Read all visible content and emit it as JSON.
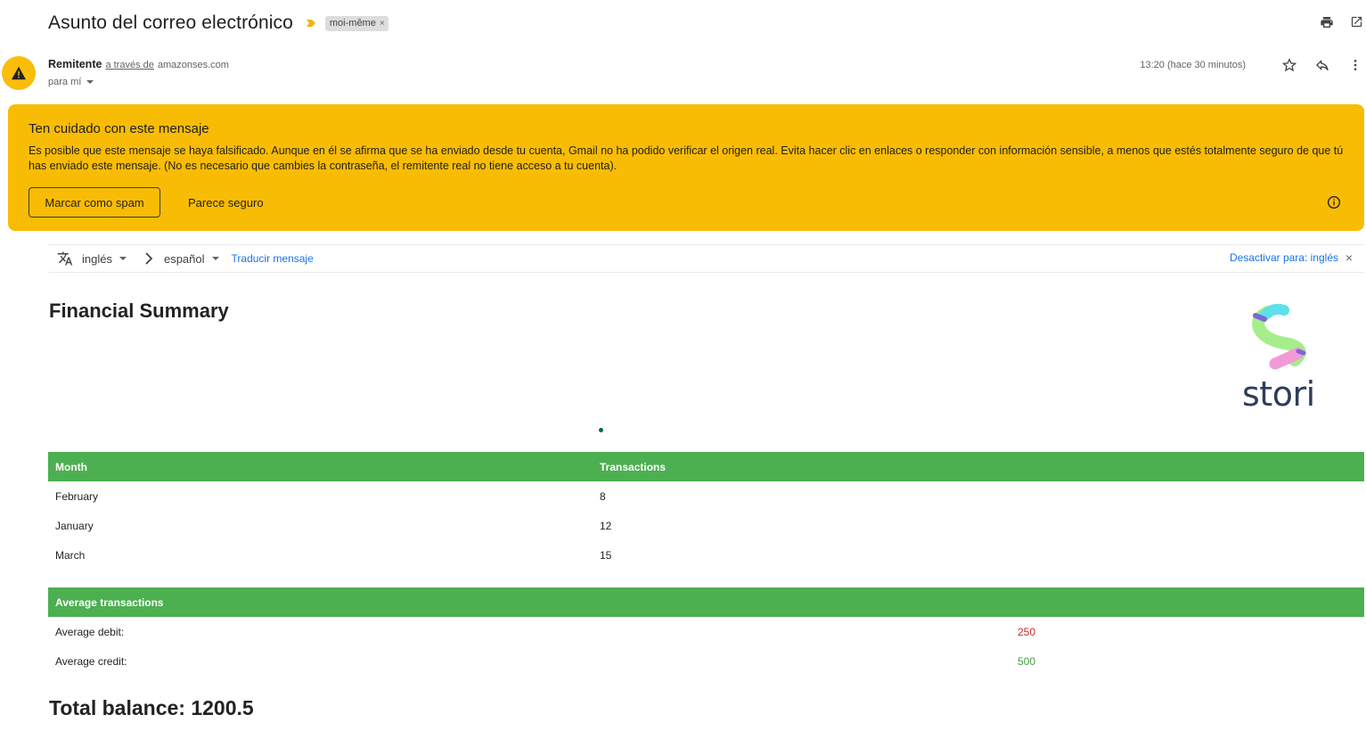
{
  "header": {
    "subject": "Asunto del correo electrónico",
    "label": "moi-même",
    "label_remove": "×",
    "icons": [
      "print-icon",
      "open-new-window-icon"
    ]
  },
  "sender": {
    "name": "Remitente",
    "via": "a través de",
    "domain": "amazonses.com",
    "to": "para mí",
    "time": "13:20 (hace 30 minutos)",
    "icons": [
      "star-icon",
      "reply-icon",
      "more-vert-icon"
    ]
  },
  "warning": {
    "title": "Ten cuidado con este mensaje",
    "body": "Es posible que este mensaje se haya falsificado. Aunque en él se afirma que se ha enviado desde tu cuenta, Gmail no ha podido verificar el origen real. Evita hacer clic en enlaces o responder con información sensible, a menos que estés totalmente seguro de que tú has enviado este mensaje. (No es necesario que cambies la contraseña, el remitente real no tiene acceso a tu cuenta).",
    "spam_button": "Marcar como spam",
    "safe_button": "Parece seguro",
    "color": "#f9bc05"
  },
  "translate": {
    "from_lang": "inglés",
    "to_lang": "español",
    "translate_link": "Traducir mensaje",
    "disable_link": "Desactivar para: inglés",
    "close": "×"
  },
  "content": {
    "title": "Financial Summary",
    "logo_text": "stori",
    "transactions_table": {
      "headers": [
        "Month",
        "Transactions"
      ],
      "rows": [
        [
          "February",
          "8"
        ],
        [
          "January",
          "12"
        ],
        [
          "March",
          "15"
        ]
      ]
    },
    "average_table": {
      "header": "Average transactions",
      "rows": [
        {
          "label": "Average debit:",
          "value": "250"
        },
        {
          "label": "Average credit:",
          "value": "500"
        }
      ]
    },
    "total_balance": "Total balance: 1200.5",
    "header_color": "#4caf50",
    "debit_color": "#c62828",
    "credit_color": "#43a047"
  }
}
